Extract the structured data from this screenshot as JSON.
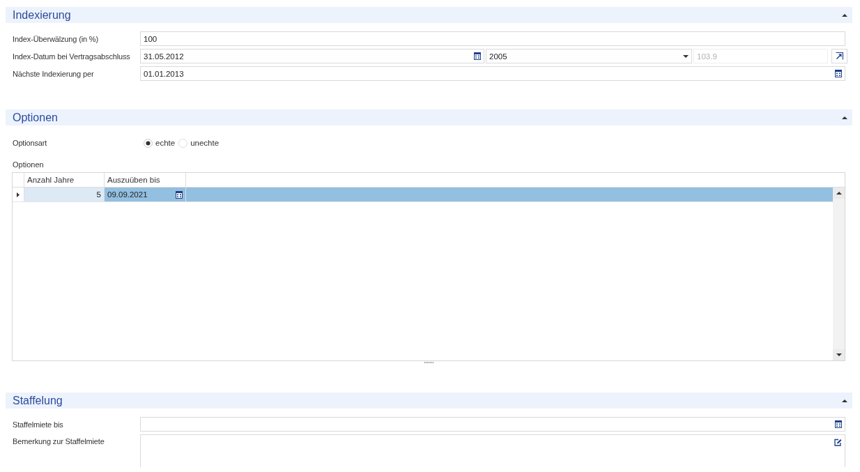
{
  "sections": [
    {
      "title": "Indexierung",
      "expanded": true,
      "rows": [
        {
          "kind": "text",
          "label": "Index-Überwälzung (in %)",
          "value": "100"
        },
        {
          "kind": "index-date",
          "label": "Index-Datum bei Vertragsabschluss",
          "date": "31.05.2012",
          "base_year": "2005",
          "index_value": "103.9"
        },
        {
          "kind": "date",
          "label": "Nächste Indexierung per",
          "value": "01.01.2013"
        }
      ]
    },
    {
      "title": "Optionen",
      "expanded": true,
      "rows": [
        {
          "kind": "radio",
          "label": "Optionsart",
          "options": [
            {
              "label": "echte",
              "selected": true
            },
            {
              "label": "unechte",
              "selected": false
            }
          ]
        },
        {
          "kind": "grid",
          "label": "Optionen",
          "columns": [
            {
              "label": "Anzahl Jahre",
              "kind": "number"
            },
            {
              "label": "Auszuüben bis",
              "kind": "date"
            }
          ],
          "rows": [
            {
              "selected": true,
              "cells": [
                {
                  "value": "5",
                  "focused": true
                },
                {
                  "value": "09.09.2021",
                  "focused": false
                }
              ]
            }
          ]
        }
      ]
    },
    {
      "title": "Staffelung",
      "expanded": true,
      "rows": [
        {
          "kind": "date",
          "label": "Staffelmiete bis"
        },
        {
          "kind": "memo",
          "label": "Bemerkung zur Staffelmiete"
        }
      ]
    }
  ]
}
